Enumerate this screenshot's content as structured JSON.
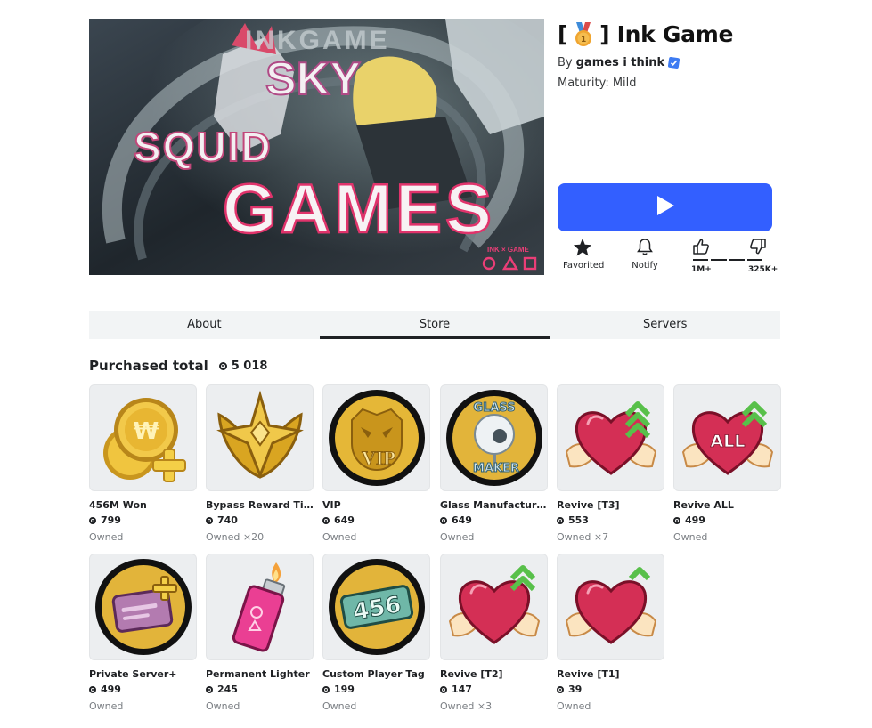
{
  "game": {
    "title": "[ 🥇 ] Ink Game",
    "title_prefix": "[",
    "title_suffix": "] Ink Game",
    "by_label": "By",
    "creator": "games i think",
    "maturity": "Maturity: Mild",
    "thumbnail_text": {
      "top": "INKGAME",
      "line1": "SKY",
      "line2": "SQUID",
      "line3": "GAMES",
      "badge": "INK × GAME"
    }
  },
  "actions": {
    "favorite_label": "Favorited",
    "notify_label": "Notify",
    "upvotes": "1M+",
    "downvotes": "325K+"
  },
  "tabs": [
    {
      "label": "About",
      "active": false
    },
    {
      "label": "Store",
      "active": true
    },
    {
      "label": "Servers",
      "active": false
    }
  ],
  "store": {
    "purchased_label": "Purchased total",
    "purchased_total": "5 018",
    "items": [
      {
        "name": "456M Won",
        "price": "799",
        "status": "Owned",
        "icon": "coins-icon"
      },
      {
        "name": "Bypass Reward Time",
        "price": "740",
        "status": "Owned ×20",
        "icon": "star-badge-icon"
      },
      {
        "name": "VIP",
        "price": "649",
        "status": "Owned",
        "icon": "vip-lion-icon"
      },
      {
        "name": "Glass Manufacturer...",
        "price": "649",
        "status": "Owned",
        "icon": "glass-maker-icon"
      },
      {
        "name": "Revive [T3]",
        "price": "553",
        "status": "Owned ×7",
        "icon": "winged-heart-t3-icon"
      },
      {
        "name": "Revive ALL",
        "price": "499",
        "status": "Owned",
        "icon": "winged-heart-all-icon",
        "badge_text": "ALL"
      },
      {
        "name": "Private Server+",
        "price": "499",
        "status": "Owned",
        "icon": "private-server-icon"
      },
      {
        "name": "Permanent Lighter",
        "price": "245",
        "status": "Owned",
        "icon": "lighter-icon"
      },
      {
        "name": "Custom Player Tag",
        "price": "199",
        "status": "Owned",
        "icon": "player-tag-icon",
        "badge_text": "456"
      },
      {
        "name": "Revive [T2]",
        "price": "147",
        "status": "Owned ×3",
        "icon": "winged-heart-t2-icon"
      },
      {
        "name": "Revive [T1]",
        "price": "39",
        "status": "Owned",
        "icon": "winged-heart-t1-icon"
      }
    ]
  },
  "colors": {
    "play_button": "#335fff",
    "tab_bg": "#f2f4f5",
    "card_bg": "#eceef0",
    "muted_text": "#7b7f84"
  }
}
